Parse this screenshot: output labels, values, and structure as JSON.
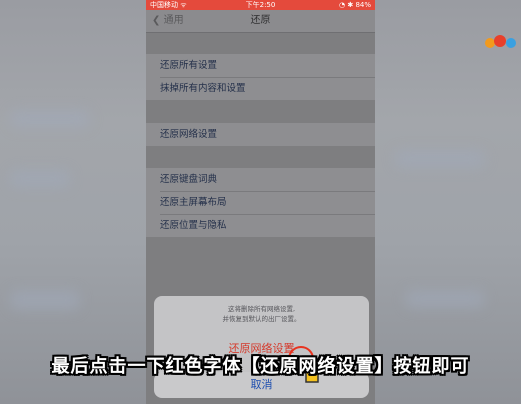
{
  "status_bar": {
    "carrier": "中国移动 ᯤ",
    "time": "下午2:50",
    "right": "◔ ✱ 84%"
  },
  "nav": {
    "back_label": "通用",
    "title": "还原"
  },
  "groups": [
    {
      "items": [
        "还原所有设置",
        "抹掉所有内容和设置"
      ]
    },
    {
      "items": [
        "还原网络设置"
      ]
    },
    {
      "items": [
        "还原键盘词典",
        "还原主屏幕布局",
        "还原位置与隐私"
      ]
    }
  ],
  "sheet": {
    "message_line1": "这将删除所有网络设置,",
    "message_line2": "并恢复到默认的出厂设置。",
    "action_label": "还原网络设置",
    "cancel_label": "取消"
  },
  "subtitle": "最后点击一下红色字体【还原网络设置】按钮即可",
  "colors": {
    "status_bar": "#e44a3c",
    "action_red": "#d43a2c",
    "cancel_blue": "#1f4fb0"
  }
}
